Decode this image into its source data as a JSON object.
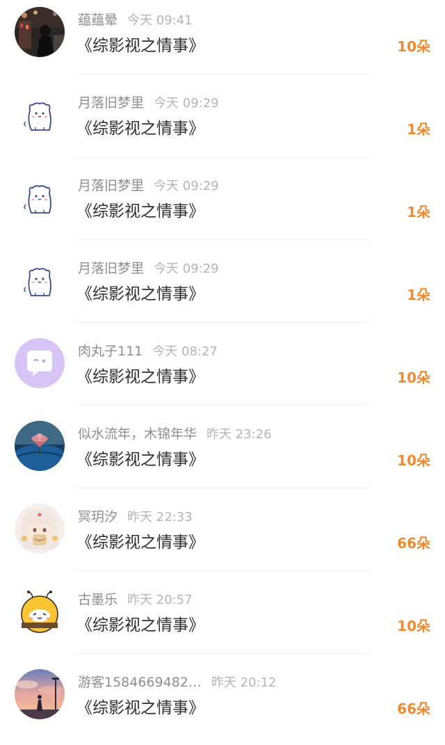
{
  "gift_list": [
    {
      "name": "蕴蕴晕",
      "time": "今天 09:41",
      "book": "《综影视之情事》",
      "amount": "10朵",
      "avatar": "dark-night-photo-avatar"
    },
    {
      "name": "月落旧梦里",
      "time": "今天 09:29",
      "book": "《综影视之情事》",
      "amount": "1朵",
      "avatar": "cartoon-bear-avatar"
    },
    {
      "name": "月落旧梦里",
      "time": "今天 09:29",
      "book": "《综影视之情事》",
      "amount": "1朵",
      "avatar": "cartoon-bear-avatar"
    },
    {
      "name": "月落旧梦里",
      "time": "今天 09:29",
      "book": "《综影视之情事》",
      "amount": "1朵",
      "avatar": "cartoon-bear-avatar"
    },
    {
      "name": "肉丸子111",
      "time": "今天 08:27",
      "book": "《综影视之情事》",
      "amount": "10朵",
      "avatar": "purple-chat-bubble-avatar"
    },
    {
      "name": "似水流年，木锦年华",
      "time": "昨天 23:26",
      "book": "《综影视之情事》",
      "amount": "10朵",
      "avatar": "lotus-photo-avatar"
    },
    {
      "name": "冥玥汐",
      "time": "昨天 22:33",
      "book": "《综影视之情事》",
      "amount": "66朵",
      "avatar": "anime-girl-avatar"
    },
    {
      "name": "古墨乐",
      "time": "昨天 20:57",
      "book": "《综影视之情事》",
      "amount": "10朵",
      "avatar": "yellow-bee-avatar"
    },
    {
      "name": "游客1584669482…",
      "time": "昨天 20:12",
      "book": "《综影视之情事》",
      "amount": "66朵",
      "avatar": "sunset-figure-avatar"
    }
  ],
  "colors": {
    "amount": "#f08a2e",
    "name": "#8e8e8e",
    "time": "#b5b5b5",
    "book": "#2f2f2f",
    "avatar_purple": "#d6c4f4"
  }
}
